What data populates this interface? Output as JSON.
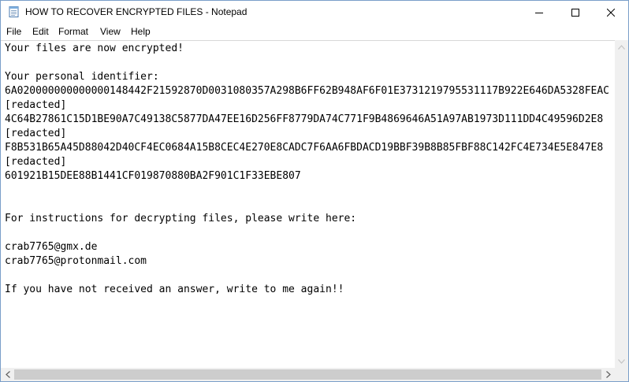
{
  "window": {
    "title": "HOW TO RECOVER ENCRYPTED FILES - Notepad",
    "icon": "notepad-icon"
  },
  "menu": {
    "file": "File",
    "edit": "Edit",
    "format": "Format",
    "view": "View",
    "help": "Help"
  },
  "document": {
    "lines": [
      "Your files are now encrypted!",
      "",
      "Your personal identifier:",
      "6A020000000000000148442F21592870D0031080357A298B6FF62B948AF6F01E3731219795531117B922E646DA5328FEAC",
      "[redacted]",
      "4C64B27861C15D1BE90A7C49138C5877DA47EE16D256FF8779DA74C771F9B4869646A51A97AB1973D111DD4C49596D2E8",
      "[redacted]",
      "F8B531B65A45D88042D40CF4EC0684A15B8CEC4E270E8CADC7F6AA6FBDACD19BBF39B8B85FBF88C142FC4E734E5E847E8",
      "[redacted]",
      "601921B15DEE88B1441CF019870880BA2F901C1F33EBE807",
      "",
      "",
      "For instructions for decrypting files, please write here:",
      "",
      "crab7765@gmx.de",
      "crab7765@protonmail.com",
      "",
      "If you have not received an answer, write to me again!!"
    ]
  },
  "colors": {
    "window_border": "#7a9ec9",
    "scrollbar_track": "#f0f0f0",
    "scrollbar_thumb": "#cdcdcd"
  }
}
